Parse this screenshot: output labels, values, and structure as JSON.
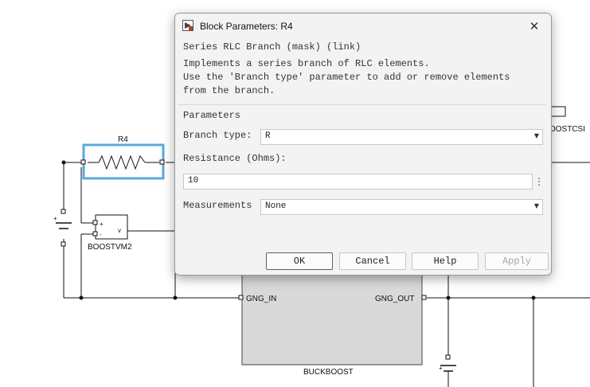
{
  "dialog": {
    "title": "Block Parameters: R4",
    "close_glyph": "✕",
    "header": "Series RLC Branch (mask) (link)",
    "description_lines": [
      "Implements a series branch of RLC elements.",
      "Use the 'Branch type' parameter to add or remove elements",
      "from the branch."
    ],
    "parameters_heading": "Parameters",
    "branch_type": {
      "label": "Branch type:",
      "value": "R"
    },
    "resistance": {
      "label": "Resistance (Ohms):",
      "value": "10"
    },
    "measurements": {
      "label": "Measurements",
      "value": "None"
    },
    "buttons": {
      "ok": "OK",
      "cancel": "Cancel",
      "help": "Help",
      "apply": "Apply"
    }
  },
  "model": {
    "resistor_name": "R4",
    "voltmeter_name": "BOOSTVM2",
    "voltmeter_plus": "+",
    "voltmeter_minus": "-",
    "voltmeter_output": "v",
    "subsystem_name": "BUCKBOOST",
    "port_in": "GNG_IN",
    "port_out": "GNG_OUT",
    "current_sensor_partial": "OOSTCSI",
    "source_plus_left": "+",
    "source_plus_right": "+"
  },
  "colors": {
    "selection": "#5aa9de",
    "wire": "#111111",
    "subsystem_fill": "#d9d9d9"
  },
  "icons": {
    "app": "simulink-block-icon",
    "close": "close-icon",
    "dropdown": "chevron-down-icon",
    "more": "vertical-ellipsis-icon"
  }
}
